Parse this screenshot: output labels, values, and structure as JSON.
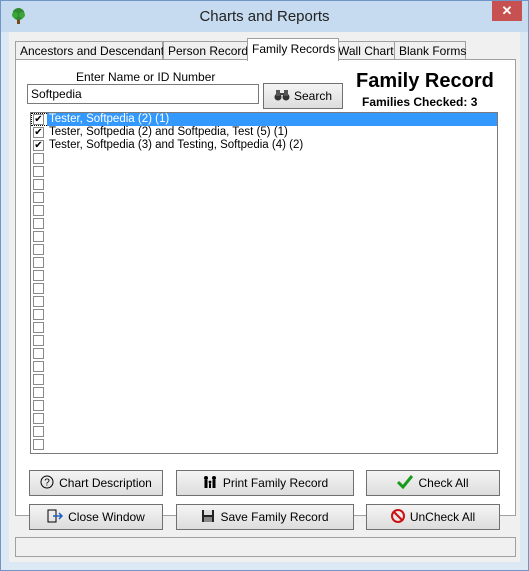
{
  "window": {
    "title": "Charts and Reports",
    "close_glyph": "✕"
  },
  "tabs": [
    {
      "label": "Ancestors and Descendants",
      "active": false
    },
    {
      "label": "Person Record",
      "active": false
    },
    {
      "label": "Family Records",
      "active": true
    },
    {
      "label": "Wall Chart",
      "active": false
    },
    {
      "label": "Blank Forms",
      "active": false
    }
  ],
  "search": {
    "label": "Enter Name or ID Number",
    "value": "Softpedia",
    "button_label": "Search"
  },
  "header": {
    "title": "Family Record",
    "families_checked": "Families Checked: 3"
  },
  "list": {
    "rows": [
      {
        "text": "Tester, Softpedia (2)  (1)",
        "checked": true,
        "selected": true
      },
      {
        "text": "Tester, Softpedia (2)  and  Softpedia, Test (5)  (1)",
        "checked": true,
        "selected": false
      },
      {
        "text": "Tester, Softpedia (3)  and  Testing, Softpedia (4)  (2)",
        "checked": true,
        "selected": false
      }
    ],
    "empty_rows": 23
  },
  "buttons": {
    "chart_description": "Chart Description",
    "print_family_record": "Print Family Record",
    "check_all": "Check All",
    "close_window": "Close Window",
    "save_family_record": "Save Family Record",
    "uncheck_all": "UnCheck All"
  },
  "colors": {
    "selection": "#3399ff",
    "check_green": "#1a9a1a",
    "uncheck_red": "#cc1111"
  }
}
